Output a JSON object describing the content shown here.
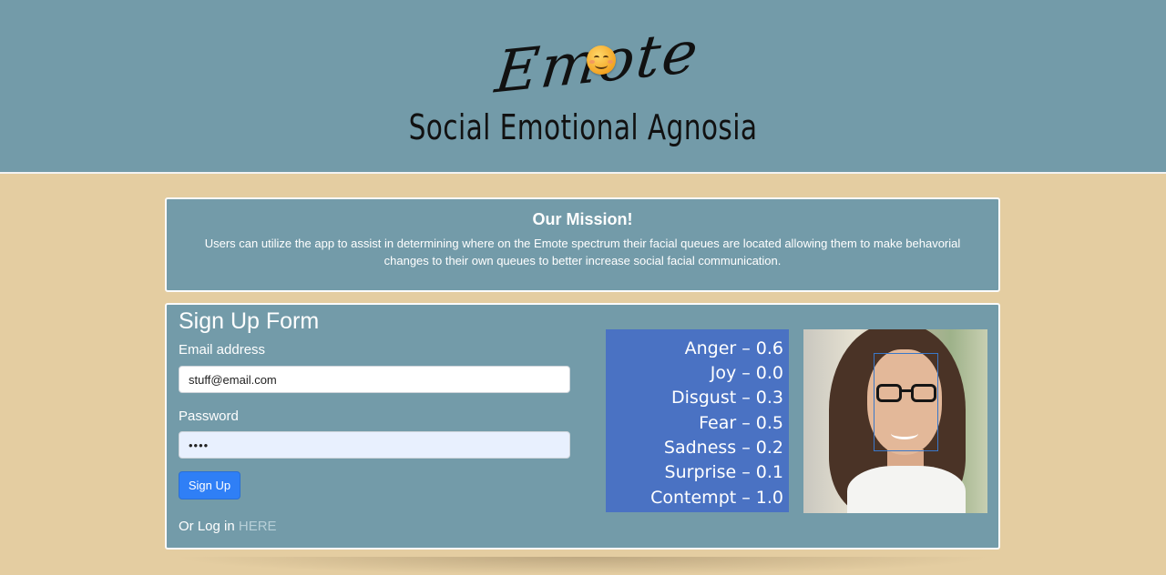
{
  "header": {
    "logo_text": "Emote",
    "subtitle": "Social Emotional Agnosia"
  },
  "mission": {
    "title": "Our Mission!",
    "text": "Users can utilize the app to assist in determining where on the Emote spectrum their facial queues are located allowing them to make behavorial changes to their own queues to better increase social facial communication."
  },
  "signup": {
    "title": "Sign Up Form",
    "email_label": "Email address",
    "email_value": "stuff@email.com",
    "password_label": "Password",
    "password_value": "••••",
    "button_label": "Sign Up",
    "login_prefix": "Or Log in",
    "login_link": "HERE"
  },
  "emotions": [
    "Anger – 0.6",
    "Joy – 0.0",
    "Disgust – 0.3",
    "Fear – 0.5",
    "Sadness – 0.2",
    "Surprise – 0.1",
    "Contempt – 1.0"
  ],
  "colors": {
    "header_bg": "#739ba9",
    "page_bg": "#e4cda1",
    "scores_bg": "#4a72c3",
    "button_bg": "#2f7ff6"
  }
}
